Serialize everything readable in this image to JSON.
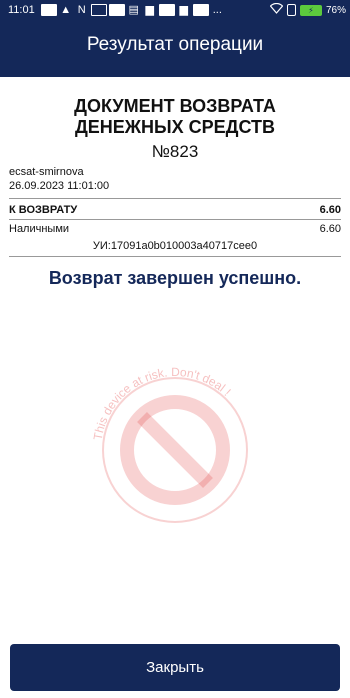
{
  "status_bar": {
    "time": "11:01",
    "more": "...",
    "battery_percent": "76%",
    "icons": [
      "notification-icon",
      "image-icon",
      "nfc-icon",
      "message-icon",
      "card-icon",
      "printer-icon",
      "notification-icon",
      "printer-icon",
      "notification-icon",
      "wifi-icon",
      "sim-icon",
      "battery-icon"
    ]
  },
  "header": {
    "title": "Результат операции"
  },
  "document": {
    "title_line1": "ДОКУМЕНТ ВОЗВРАТА",
    "title_line2": "ДЕНЕЖНЫХ СРЕДСТВ",
    "number": "№823",
    "user": "ecsat-smirnova",
    "datetime": "26.09.2023 11:01:00",
    "refund_label": "К ВОЗВРАТУ",
    "refund_value": "6.60",
    "cash_label": "Наличными",
    "cash_value": "6.60",
    "uid": "УИ:17091a0b010003a40717cee0"
  },
  "result_message": "Возврат завершен успешно.",
  "watermark": {
    "text": "This device at risk. Don't deal !"
  },
  "actions": {
    "close_label": "Закрыть"
  },
  "colors": {
    "brand": "#142859",
    "watermark": "#e03030",
    "battery": "#5cc93d"
  }
}
